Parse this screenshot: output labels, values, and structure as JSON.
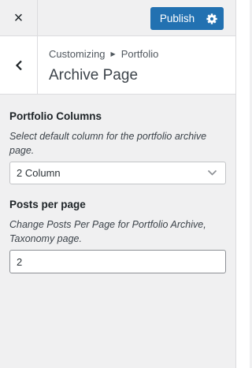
{
  "topbar": {
    "close_glyph": "×",
    "publish_label": "Publish",
    "close_icon": "close-icon",
    "settings_icon": "gear-icon"
  },
  "section": {
    "breadcrumb_parent": "Customizing",
    "breadcrumb_child": "Portfolio",
    "title": "Archive Page",
    "back_icon": "chevron-left-icon"
  },
  "controls": {
    "columns": {
      "label": "Portfolio Columns",
      "description": "Select default column for the portfolio archive page.",
      "selected": "2 Column"
    },
    "posts": {
      "label": "Posts per page",
      "description": "Change Posts Per Page for Portfolio Archive, Taxonomy page.",
      "value": "2"
    }
  },
  "colors": {
    "accent": "#2271b1",
    "panel_bg": "#f0f0f1"
  }
}
